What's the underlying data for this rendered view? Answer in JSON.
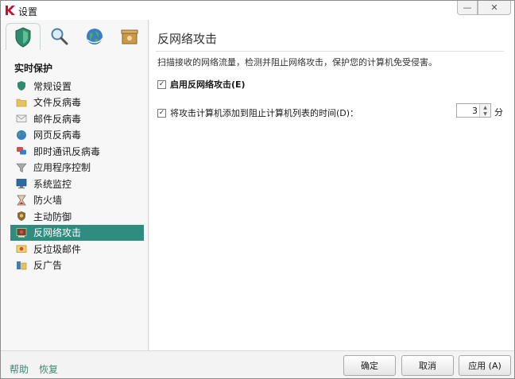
{
  "window": {
    "title": "设置",
    "minimize_symbol": "—",
    "close_symbol": "✕"
  },
  "sidebar": {
    "tabs": [
      {
        "name": "protection-tab",
        "icon": "shield-icon"
      },
      {
        "name": "scan-tab",
        "icon": "magnifier-icon"
      },
      {
        "name": "update-tab",
        "icon": "globe-icon"
      },
      {
        "name": "options-tab",
        "icon": "box-icon"
      }
    ],
    "section_title": "实时保护",
    "items": [
      {
        "label": "常规设置",
        "icon": "shield-icon"
      },
      {
        "label": "文件反病毒",
        "icon": "folder-icon"
      },
      {
        "label": "邮件反病毒",
        "icon": "envelope-icon"
      },
      {
        "label": "网页反病毒",
        "icon": "globe-icon"
      },
      {
        "label": "即时通讯反病毒",
        "icon": "chat-icon"
      },
      {
        "label": "应用程序控制",
        "icon": "funnel-icon"
      },
      {
        "label": "系统监控",
        "icon": "monitor-icon"
      },
      {
        "label": "防火墙",
        "icon": "hourglass-icon"
      },
      {
        "label": "主动防御",
        "icon": "guard-icon"
      },
      {
        "label": "反网络攻击",
        "icon": "network-attack-icon"
      },
      {
        "label": "反垃圾邮件",
        "icon": "spam-icon"
      },
      {
        "label": "反广告",
        "icon": "ad-icon"
      }
    ],
    "selected_index": 9
  },
  "main": {
    "title": "反网络攻击",
    "description": "扫描接收的网络流量，检测并阻止网络攻击，保护您的计算机免受侵害。",
    "enable_label": "启用反网络攻击(E)",
    "enable_checked": true,
    "block_label": "将攻击计算机添加到阻止计算机列表的时间(D)：",
    "block_checked": true,
    "block_minutes": "3",
    "unit": "分"
  },
  "footer": {
    "help": "帮助",
    "restore": "恢复",
    "ok": "确定",
    "cancel": "取消",
    "apply": "应用 (A)"
  },
  "colors": {
    "accent": "#2f8d80",
    "link": "#3a8a74"
  }
}
